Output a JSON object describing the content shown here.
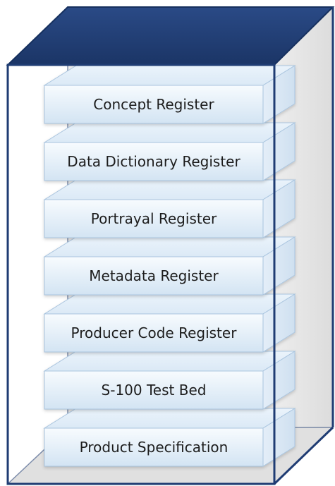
{
  "diagram": {
    "layers": [
      {
        "label": "Concept Register"
      },
      {
        "label": "Data Dictionary Register"
      },
      {
        "label": "Portrayal Register"
      },
      {
        "label": "Metadata Register"
      },
      {
        "label": "Producer Code Register"
      },
      {
        "label": "S-100 Test Bed"
      },
      {
        "label": "Product Specification"
      }
    ],
    "colors": {
      "cabinet_top": "#1f3c73",
      "cabinet_edge": "#1f3c73",
      "cabinet_back": "#ececec",
      "cabinet_side": "#e3e3e3",
      "slab_front_top": "#f7fbfe",
      "slab_front_bottom": "#d3e4f3",
      "slab_edge": "#a9c4de"
    }
  }
}
